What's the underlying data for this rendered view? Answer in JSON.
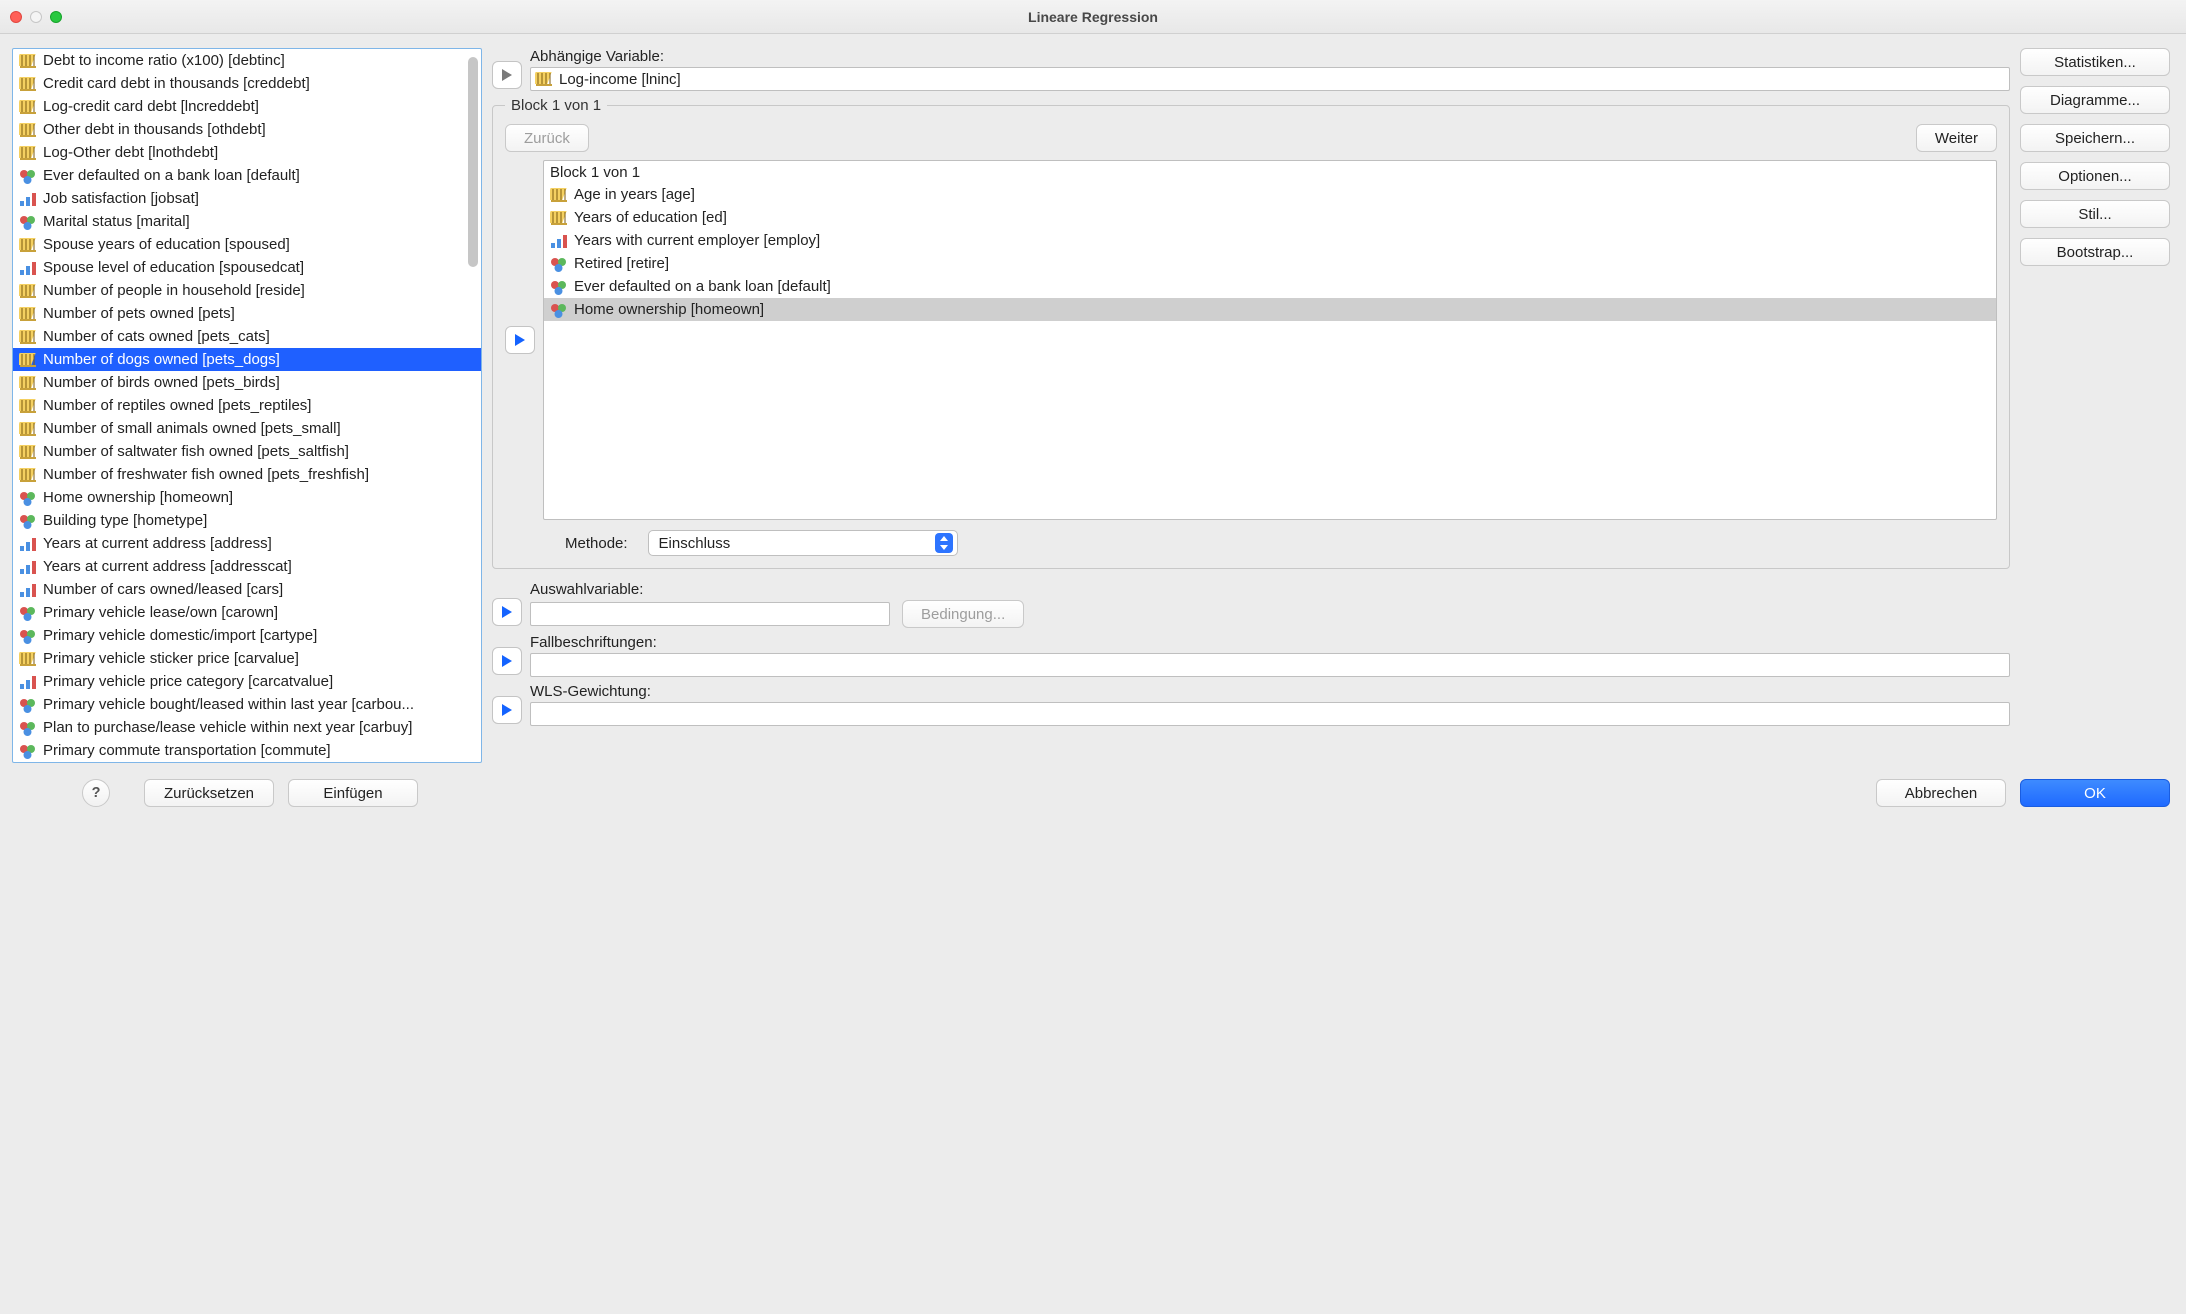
{
  "window": {
    "title": "Lineare Regression"
  },
  "source_vars": [
    {
      "icon": "scale",
      "label": "Debt to income ratio (x100) [debtinc]"
    },
    {
      "icon": "scale",
      "label": "Credit card debt in thousands [creddebt]"
    },
    {
      "icon": "scale",
      "label": "Log-credit card debt [lncreddebt]"
    },
    {
      "icon": "scale",
      "label": "Other debt in thousands [othdebt]"
    },
    {
      "icon": "scale",
      "label": "Log-Other debt [lnothdebt]"
    },
    {
      "icon": "nominal",
      "label": "Ever defaulted on a bank loan [default]"
    },
    {
      "icon": "ordinal",
      "label": "Job satisfaction [jobsat]"
    },
    {
      "icon": "nominal",
      "label": "Marital status [marital]"
    },
    {
      "icon": "scale",
      "label": "Spouse years of education [spoused]"
    },
    {
      "icon": "ordinal",
      "label": "Spouse level of education [spousedcat]"
    },
    {
      "icon": "scale",
      "label": "Number of people in household [reside]"
    },
    {
      "icon": "scale",
      "label": "Number of pets owned [pets]"
    },
    {
      "icon": "scale",
      "label": "Number of cats owned [pets_cats]"
    },
    {
      "icon": "scale",
      "label": "Number of dogs owned [pets_dogs]",
      "selected": true
    },
    {
      "icon": "scale",
      "label": "Number of birds owned [pets_birds]"
    },
    {
      "icon": "scale",
      "label": "Number of reptiles owned [pets_reptiles]"
    },
    {
      "icon": "scale",
      "label": "Number of small animals owned [pets_small]"
    },
    {
      "icon": "scale",
      "label": "Number of saltwater fish owned [pets_saltfish]"
    },
    {
      "icon": "scale",
      "label": "Number of freshwater fish owned [pets_freshfish]"
    },
    {
      "icon": "nominal",
      "label": "Home ownership [homeown]"
    },
    {
      "icon": "nominal",
      "label": "Building type [hometype]"
    },
    {
      "icon": "ordinal",
      "label": "Years at current address [address]"
    },
    {
      "icon": "ordinal",
      "label": "Years at current address [addresscat]"
    },
    {
      "icon": "ordinal",
      "label": "Number of cars owned/leased [cars]"
    },
    {
      "icon": "nominal",
      "label": "Primary vehicle lease/own [carown]"
    },
    {
      "icon": "nominal",
      "label": "Primary vehicle domestic/import [cartype]"
    },
    {
      "icon": "scale",
      "label": "Primary vehicle sticker price [carvalue]"
    },
    {
      "icon": "ordinal",
      "label": "Primary vehicle price category [carcatvalue]"
    },
    {
      "icon": "nominal",
      "label": "Primary vehicle bought/leased within last year [carbou..."
    },
    {
      "icon": "nominal",
      "label": "Plan to purchase/lease vehicle within next year [carbuy]"
    },
    {
      "icon": "nominal",
      "label": "Primary commute transportation [commute]"
    }
  ],
  "dep": {
    "label": "Abhängige Variable:",
    "icon": "scale",
    "value": "Log-income [lninc]"
  },
  "block": {
    "legend": "Block 1 von 1",
    "prev": "Zurück",
    "next": "Weiter",
    "header": "Block 1 von 1",
    "items": [
      {
        "icon": "scale",
        "label": "Age in years [age]"
      },
      {
        "icon": "scale",
        "label": "Years of education [ed]"
      },
      {
        "icon": "ordinal",
        "label": "Years with current employer [employ]"
      },
      {
        "icon": "nominal",
        "label": "Retired [retire]"
      },
      {
        "icon": "nominal",
        "label": "Ever defaulted on a bank loan [default]"
      },
      {
        "icon": "nominal",
        "label": "Home ownership [homeown]",
        "selected": true
      }
    ],
    "method_label": "Methode:",
    "method_value": "Einschluss"
  },
  "selvar": {
    "label": "Auswahlvariable:",
    "rule_btn": "Bedingung..."
  },
  "caselabels": {
    "label": "Fallbeschriftungen:"
  },
  "wls": {
    "label": "WLS-Gewichtung:"
  },
  "right_buttons": [
    "Statistiken...",
    "Diagramme...",
    "Speichern...",
    "Optionen...",
    "Stil...",
    "Bootstrap..."
  ],
  "footer": {
    "help": "?",
    "reset": "Zurücksetzen",
    "paste": "Einfügen",
    "cancel": "Abbrechen",
    "ok": "OK"
  }
}
